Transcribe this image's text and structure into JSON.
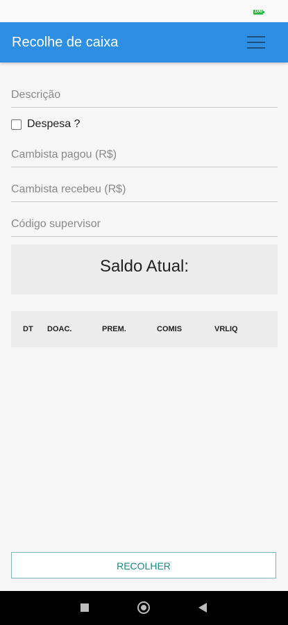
{
  "status_bar": {
    "battery_icon": "battery-icon",
    "battery_text": "100"
  },
  "app_bar": {
    "title": "Recolhe de caixa",
    "menu_icon": "hamburger-menu-icon",
    "color": "#2d8fe4"
  },
  "form": {
    "descricao": {
      "placeholder": "Descrição",
      "value": ""
    },
    "despesa": {
      "label": "Despesa ?",
      "checked": false
    },
    "cambista_pagou": {
      "placeholder": "Cambista pagou (R$)",
      "value": ""
    },
    "cambista_recebeu": {
      "placeholder": "Cambista recebeu (R$)",
      "value": ""
    },
    "codigo_supervisor": {
      "placeholder": "Código supervisor",
      "value": ""
    }
  },
  "saldo": {
    "label": "Saldo Atual:"
  },
  "table": {
    "columns": [
      "DT",
      "DOAC.",
      "PREM.",
      "COMIS",
      "VRLIQ"
    ],
    "rows": []
  },
  "actions": {
    "recolher_label": "RECOLHER",
    "accent": "#1a8a82"
  },
  "nav_bar": {
    "recents_icon": "recents-square-icon",
    "home_icon": "home-circle-icon",
    "back_icon": "back-triangle-icon"
  }
}
